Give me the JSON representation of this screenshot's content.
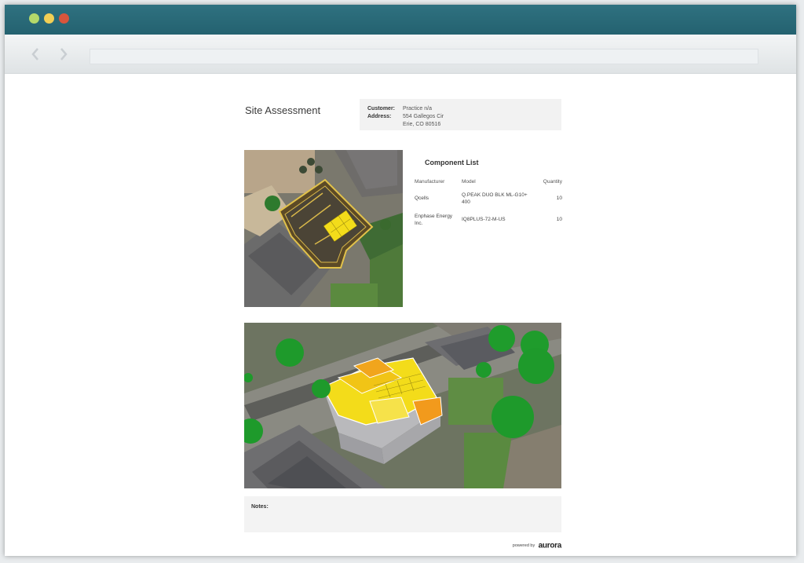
{
  "window": {
    "traffic_lights": [
      "#b5d96a",
      "#f2cf55",
      "#d9553c"
    ],
    "titlebar_color": "#2a6977"
  },
  "nav": {
    "back_icon": "chevron-left-icon",
    "forward_icon": "chevron-right-icon",
    "url": ""
  },
  "report": {
    "title": "Site Assessment",
    "customer_label": "Customer:",
    "customer": "Practice n/a",
    "address_label": "Address:",
    "address_line1": "554 Gallegos Cir",
    "address_line2": "Erie, CO 80516"
  },
  "components": {
    "title": "Component List",
    "headers": [
      "Manufacturer",
      "Model",
      "Quantity"
    ],
    "rows": [
      {
        "manufacturer": "Qcells",
        "model": "Q.PEAK DUO BLK ML-G10+ 400",
        "quantity": "10"
      },
      {
        "manufacturer": "Enphase Energy Inc.",
        "model": "IQ8PLUS-72-M-US",
        "quantity": "10"
      }
    ]
  },
  "notes": {
    "label": "Notes:"
  },
  "footer": {
    "powered_by": "powered by",
    "brand": "aurora"
  },
  "colors": {
    "panel_yellow": "#f3dc1a",
    "roof_orange": "#f1a51c",
    "tree_green": "#1e9a2b"
  }
}
